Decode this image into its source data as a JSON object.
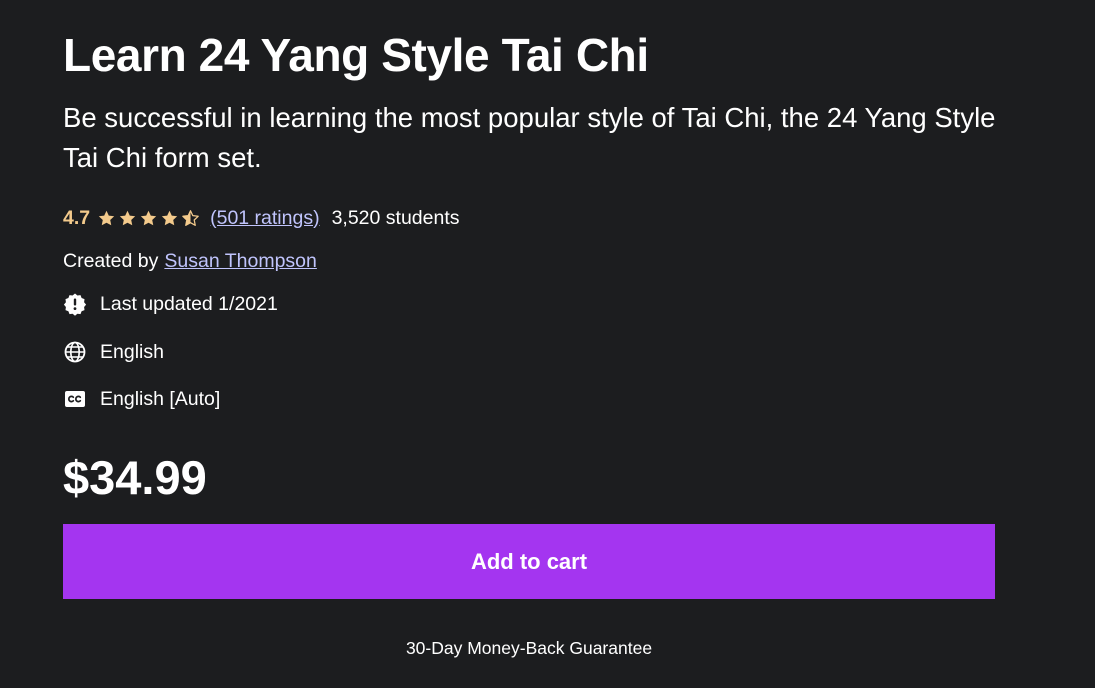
{
  "course": {
    "title": "Learn 24 Yang Style Tai Chi",
    "subtitle": "Be successful in learning the most popular style of Tai Chi, the 24 Yang Style Tai Chi form set."
  },
  "rating": {
    "value": "4.7",
    "stars": 4.7,
    "ratings_link": "(501 ratings)",
    "students": "3,520 students"
  },
  "creator": {
    "label": "Created by",
    "name": "Susan Thompson"
  },
  "meta": {
    "last_updated": "Last updated 1/2021",
    "language": "English",
    "captions": "English [Auto]"
  },
  "purchase": {
    "price": "$34.99",
    "add_to_cart_label": "Add to cart",
    "guarantee": "30-Day Money-Back Guarantee"
  },
  "colors": {
    "background": "#1c1d1f",
    "accent_button": "#a435f0",
    "rating_star": "#f3ca8c",
    "link": "#c0c4fc"
  },
  "icons": {
    "star": "star-icon",
    "half_star": "half-star-icon",
    "last_updated": "new-badge-icon",
    "language": "globe-icon",
    "captions": "closed-captions-icon"
  }
}
